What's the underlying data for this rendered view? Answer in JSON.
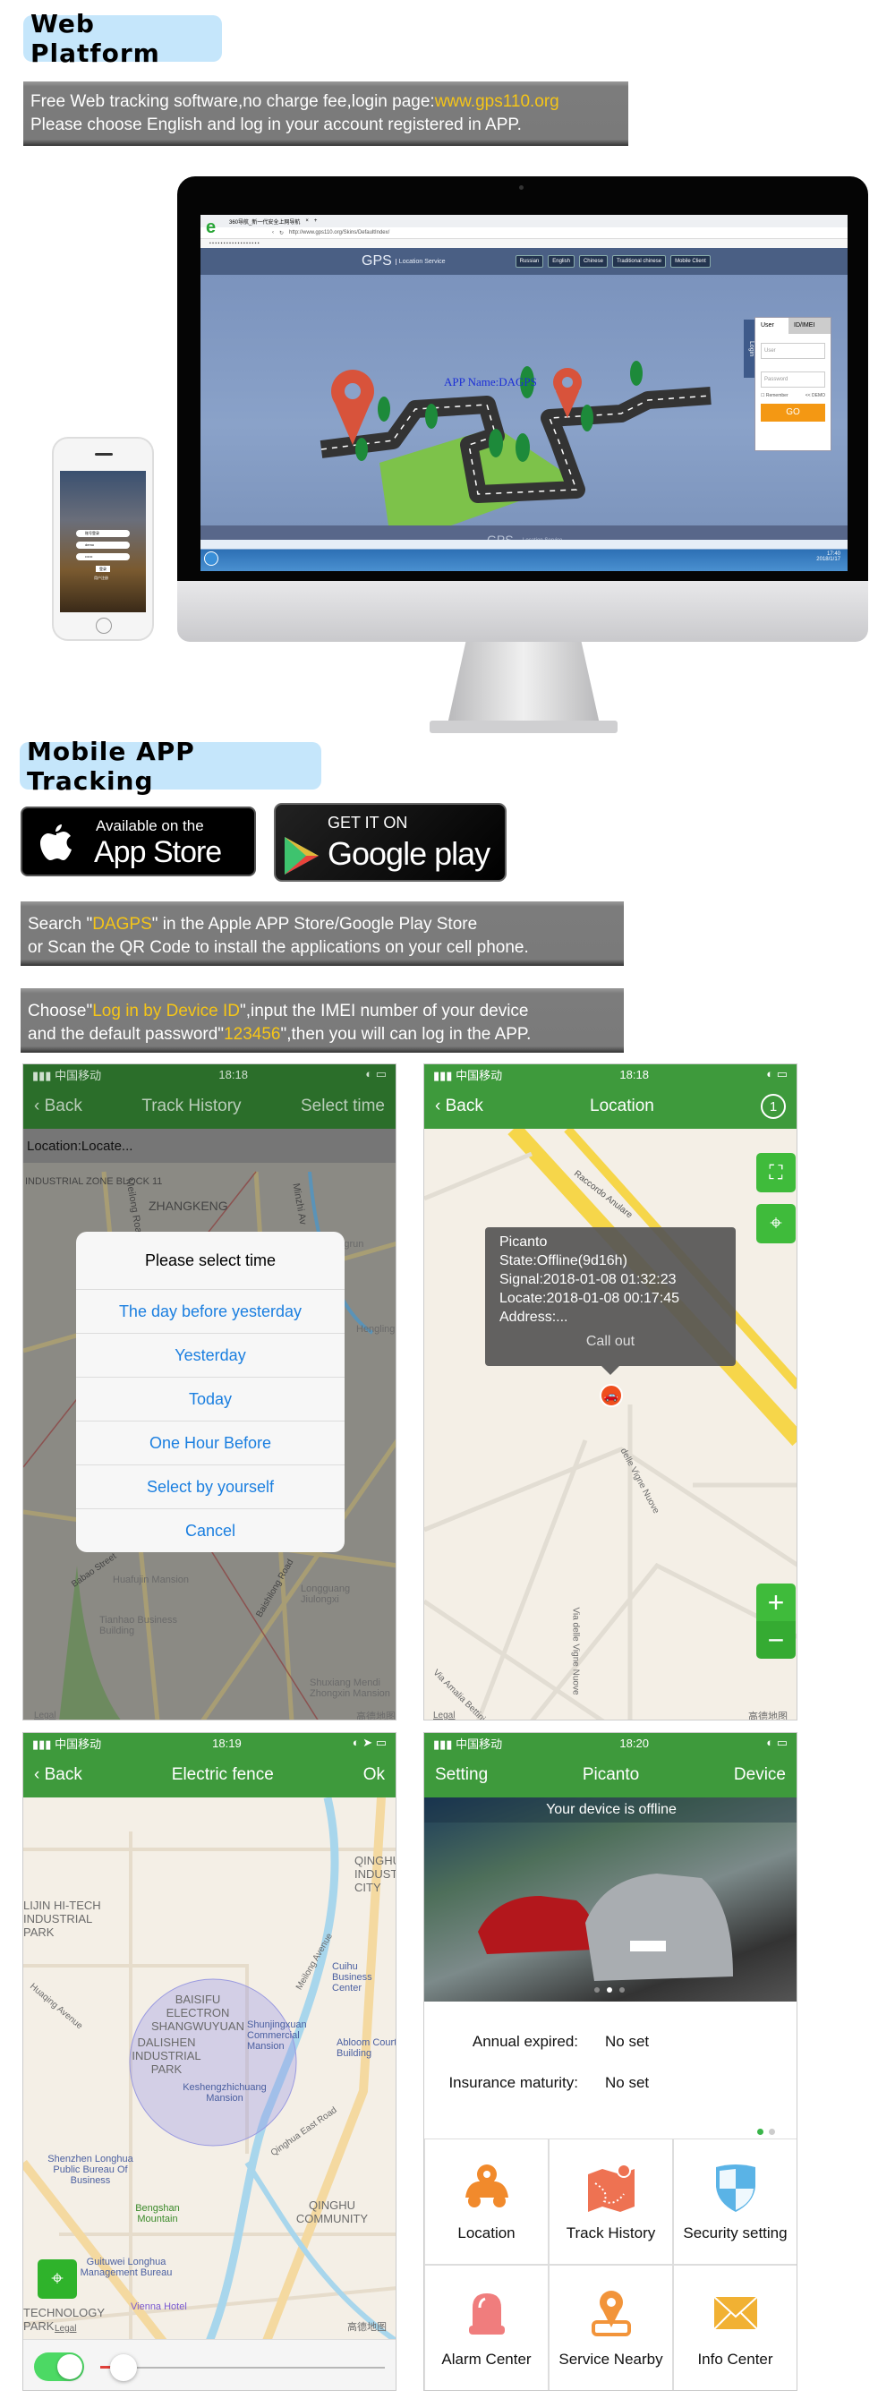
{
  "web_section": {
    "heading": "Web Platform",
    "line1_prefix": "Free Web tracking software,no charge fee,login page:",
    "line1_link": "www.gps110.org",
    "line2": "Please choose English and log in your account registered in APP."
  },
  "monitor_screen": {
    "browser_tab": "360导航_新一代安全上网导航",
    "url": "http://www.gps110.org/Skins/DefaultIndex/",
    "site_logo": "GPS",
    "site_tagline": "Location Service",
    "languages": [
      "Russian",
      "English",
      "Chinese",
      "Traditional chinese",
      "Mobile Client"
    ],
    "app_name": "APP Name:DAGPS",
    "login_tab": "Login",
    "login_tabs": [
      "User",
      "ID/IMEI"
    ],
    "user_placeholder": "User",
    "password_placeholder": "Password",
    "remember": "Remember",
    "demo": "<< DEMO",
    "go": "GO",
    "footer_logo": "GPS",
    "footer_tagline": "Location Service",
    "clock_time": "17:40",
    "clock_date": "2018/1/17"
  },
  "small_phone": {
    "fields": [
      "账号登录",
      "demo",
      "••••••"
    ],
    "login": "登录",
    "register": "用户注册"
  },
  "mobile_section": {
    "heading": "Mobile APP Tracking",
    "appstore_small": "Available on the",
    "appstore_big": "App Store",
    "gplay_small": "GET IT ON",
    "gplay_big": "Google play",
    "search_pre": "Search \"",
    "search_hl": "DAGPS",
    "search_post": "\" in the Apple APP Store/Google Play Store",
    "search_line2": "or Scan the QR Code to install the applications on your cell phone.",
    "choose_pre": "Choose\"",
    "choose_hl": "Log in by Device ID",
    "choose_post": "\",input the IMEI number of your device",
    "choose2_pre": "and the default password\"",
    "choose2_hl": "123456",
    "choose2_post": "\",then you will can log in the APP."
  },
  "phone_track": {
    "carrier": "中国移动",
    "time": "18:18",
    "back": "Back",
    "title": "Track History",
    "right": "Select time",
    "location_bar": "Location:Locate...",
    "dialog_title": "Please select time",
    "options": [
      "The day before yesterday",
      "Yesterday",
      "Today",
      "One Hour Before",
      "Select by yourself"
    ],
    "cancel": "Cancel",
    "map_labels": [
      "INDUSTRIAL ZONE BLOCK 11",
      "ZHANGKENG",
      "Meilong Road",
      "Minzhi Av",
      "Longrun",
      "Hengling",
      "Huafujin Mansion",
      "Tianhao Business Building",
      "Longguang Jiulongxi",
      "Baishilong Road",
      "Shuxiang Mendi Zhongxin Mansion",
      "Babao Street"
    ],
    "legal": "Legal",
    "map_brand": "高德地图"
  },
  "phone_location": {
    "carrier": "中国移动",
    "time": "18:18",
    "back": "Back",
    "title": "Location",
    "refresh_count": "1",
    "callout": {
      "name": "Picanto",
      "state": "State:Offline(9d16h)",
      "signal": "Signal:2018-01-08 01:32:23",
      "locate": "Locate:2018-01-08 00:17:45",
      "address": "Address:...",
      "action": "Call out"
    },
    "map_labels": [
      "Raccordo Anulare",
      "delle Vigne Nuove",
      "Via delle Vigne Nuove",
      "Via Amalia Bettini"
    ],
    "legal": "Legal",
    "map_brand": "高德地图"
  },
  "phone_fence": {
    "carrier": "中国移动",
    "time": "18:19",
    "back": "Back",
    "title": "Electric fence",
    "ok": "Ok",
    "map_labels": [
      "LIJIN HI-TECH INDUSTRIAL PARK",
      "QINGHU INDUSTRIAL CITY",
      "Meilong Avenue",
      "Huaqing Avenue",
      "BAISIFU ELECTRON SHANGWUYUAN",
      "DALISHEN INDUSTRIAL PARK",
      "Shunjingxuan Commercial Mansion",
      "Keshengzhichuang Mansion",
      "Cuihu Business Center",
      "Abloom Court Building",
      "Qinghua East Road",
      "QINGHU COMMUNITY",
      "Shenzhen Longhua Public Bureau Of Business",
      "Bengshan Mountain",
      "Guituwei Longhua Management Bureau",
      "Vienna Hotel",
      "TECHNOLOGY PARK"
    ],
    "legal": "Legal",
    "map_brand": "高德地图",
    "fence_enabled": true,
    "radius_slider": 0.05
  },
  "phone_device": {
    "carrier": "中国移动",
    "time": "18:20",
    "left": "Setting",
    "title": "Picanto",
    "right": "Device",
    "banner": "Your device is offline",
    "annual_label": "Annual expired:",
    "annual_value": "No set",
    "insurance_label": "Insurance maturity:",
    "insurance_value": "No set",
    "menu": [
      "Location",
      "Track History",
      "Security setting",
      "Alarm Center",
      "Service Nearby",
      "Info Center"
    ]
  },
  "colors": {
    "accent_green": "#3e9a3c",
    "highlight_yellow": "#f5c518",
    "heading_blue": "#c5e6fb",
    "ios_blue": "#1b7fe0"
  }
}
